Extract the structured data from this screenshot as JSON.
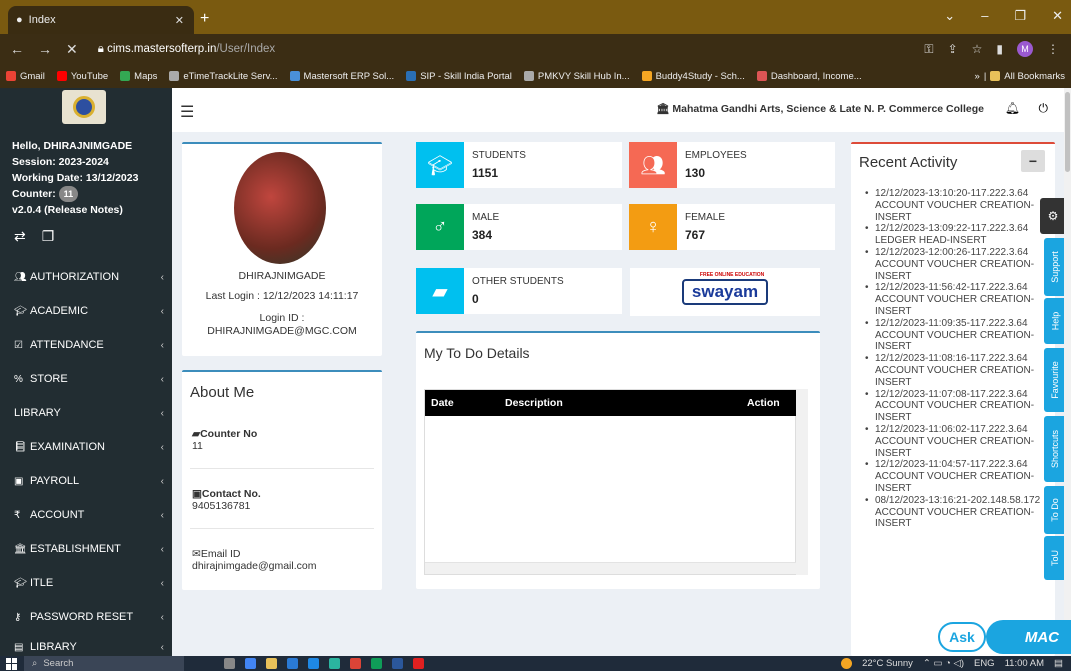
{
  "browser": {
    "tab_title": "Index",
    "url_domain": "cims.mastersofterp.in",
    "url_path": "/User/Index",
    "profile_initial": "M",
    "bookmarks": [
      "Gmail",
      "YouTube",
      "Maps",
      "eTimeTrackLite Serv...",
      "Mastersoft ERP Sol...",
      "SIP - Skill India Portal",
      "PMKVY Skill Hub In...",
      "Buddy4Study - Sch...",
      "Dashboard, Income..."
    ],
    "all_bookmarks": "All Bookmarks"
  },
  "sidebar": {
    "greeting": "Hello, DHIRAJNIMGADE",
    "session": "Session: 2023-2024",
    "working_date": "Working Date: 13/12/2023",
    "counter_label": "Counter:",
    "counter_value": "11",
    "version": "v2.0.4 (Release Notes)",
    "menu": [
      {
        "label": "AUTHORIZATION",
        "icon": "users-icon"
      },
      {
        "label": "ACADEMIC",
        "icon": "graduation-cap-icon"
      },
      {
        "label": "ATTENDANCE",
        "icon": "checkbox-icon"
      },
      {
        "label": "STORE",
        "icon": "percent-icon"
      },
      {
        "label": "LIBRARY",
        "icon": ""
      },
      {
        "label": "EXAMINATION",
        "icon": "book-icon"
      },
      {
        "label": "PAYROLL",
        "icon": "money-icon"
      },
      {
        "label": "ACCOUNT",
        "icon": "rupee-icon"
      },
      {
        "label": "ESTABLISHMENT",
        "icon": "bank-icon"
      },
      {
        "label": "ITLE",
        "icon": "graduation-cap-icon"
      },
      {
        "label": "PASSWORD RESET",
        "icon": "key-icon"
      },
      {
        "label": "LIBRARY",
        "icon": "library-icon"
      }
    ]
  },
  "header": {
    "college_name": "Mahatma Gandhi Arts, Science & Late N. P. Commerce College"
  },
  "profile": {
    "name": "DHIRAJNIMGADE",
    "last_login": "Last Login : 12/12/2023 14:11:17",
    "login_id_label": "Login ID :",
    "login_id": "DHIRAJNIMGADE@MGC.COM"
  },
  "about": {
    "title": "About Me",
    "counter_label": "Counter No",
    "counter_value": "11",
    "contact_label": "Contact No.",
    "contact_value": "9405136781",
    "email_label": "Email ID",
    "email_value": "dhirajnimgade@gmail.com"
  },
  "stats": [
    {
      "label": "STUDENTS",
      "value": "1151",
      "color": "#00c0ef"
    },
    {
      "label": "EMPLOYEES",
      "value": "130",
      "color": "#f56954"
    },
    {
      "label": "MALE",
      "value": "384",
      "color": "#00a65a"
    },
    {
      "label": "FEMALE",
      "value": "767",
      "color": "#f39c12"
    },
    {
      "label": "OTHER STUDENTS",
      "value": "0",
      "color": "#00c0ef"
    }
  ],
  "swayam": {
    "top": "FREE ONLINE EDUCATION",
    "logo": "swayam"
  },
  "todo": {
    "title": "My To Do Details",
    "columns": [
      "Date",
      "Description",
      "Action"
    ]
  },
  "recent": {
    "title": "Recent Activity",
    "items": [
      "12/12/2023-13:10:20-117.222.3.64 ACCOUNT VOUCHER CREATION-INSERT",
      "12/12/2023-13:09:22-117.222.3.64 LEDGER HEAD-INSERT",
      "12/12/2023-12:00:26-117.222.3.64 ACCOUNT VOUCHER CREATION-INSERT",
      "12/12/2023-11:56:42-117.222.3.64 ACCOUNT VOUCHER CREATION-INSERT",
      "12/12/2023-11:09:35-117.222.3.64 ACCOUNT VOUCHER CREATION-INSERT",
      "12/12/2023-11:08:16-117.222.3.64 ACCOUNT VOUCHER CREATION-INSERT",
      "12/12/2023-11:07:08-117.222.3.64 ACCOUNT VOUCHER CREATION-INSERT",
      "12/12/2023-11:06:02-117.222.3.64 ACCOUNT VOUCHER CREATION-INSERT",
      "12/12/2023-11:04:57-117.222.3.64 ACCOUNT VOUCHER CREATION-INSERT",
      "08/12/2023-13:16:21-202.148.58.172 ACCOUNT VOUCHER CREATION-INSERT"
    ]
  },
  "side_tabs": [
    "Support",
    "Help",
    "Favourite",
    "Shortcuts",
    "To Do",
    "ToU"
  ],
  "chat": {
    "ask": "Ask",
    "mac": "MAC"
  },
  "taskbar": {
    "search": "Search",
    "weather": "22°C  Sunny",
    "lang": "ENG",
    "time": "11:00 AM"
  }
}
